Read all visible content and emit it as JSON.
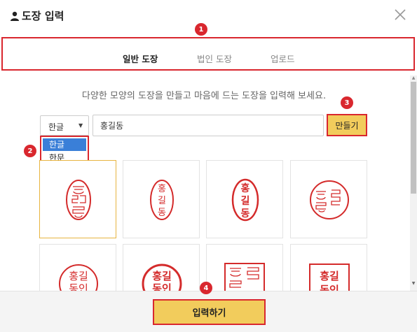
{
  "dialog": {
    "title": "도장 입력",
    "title_icon": "user-icon",
    "close_icon": "close-icon"
  },
  "tabs": [
    {
      "label": "일반 도장",
      "active": true
    },
    {
      "label": "법인 도장",
      "active": false
    },
    {
      "label": "업로드",
      "active": false
    }
  ],
  "instruction": "다양한 모양의 도장을 만들고 마음에 드는 도장을 입력해 보세요.",
  "script_select": {
    "selected": "한글",
    "options": [
      "한글",
      "한문"
    ],
    "arrow_icon": "caret-down-icon"
  },
  "name_input": {
    "value": "홍길동"
  },
  "make_button": {
    "label": "만들기"
  },
  "stamps": [
    {
      "text": "홍길동",
      "style": "oval-sealscript"
    },
    {
      "text": "홍길동",
      "style": "oval-vertical"
    },
    {
      "text": "홍길동",
      "style": "oval-vertical-bold"
    },
    {
      "text": "홍길동",
      "style": "circle-sealscript"
    },
    {
      "text": "홍길동인",
      "style": "circle"
    },
    {
      "text": "홍길동인",
      "style": "circle-bold"
    },
    {
      "text": "홍길동",
      "style": "square-sealscript"
    },
    {
      "text": "홍길동인",
      "style": "square"
    }
  ],
  "stamp_preview_text": {
    "hong": "홍",
    "gil": "길",
    "dong": "동",
    "hong_gil": "홍길",
    "dong_in": "동인"
  },
  "submit_button": {
    "label": "입력하기"
  },
  "annotations": [
    "1",
    "2",
    "3",
    "4"
  ],
  "colors": {
    "annotation_red": "#d9272e",
    "button_yellow": "#f2cc5c",
    "stamp_red": "#d42b2b",
    "selected_option": "#3a7fd8",
    "selected_stamp_border": "#e7b440"
  }
}
